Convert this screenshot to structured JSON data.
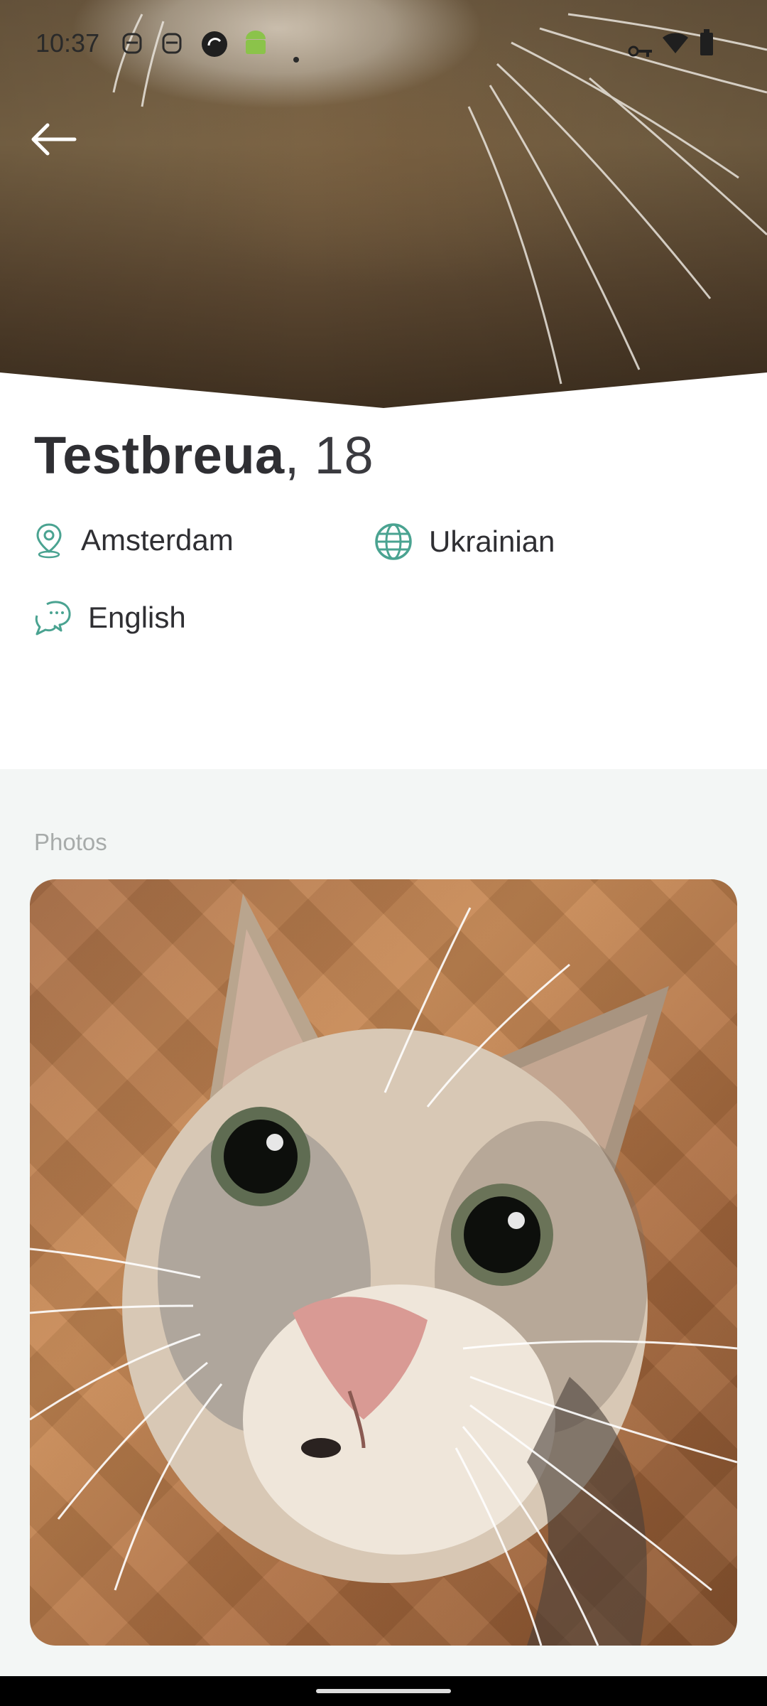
{
  "status_bar": {
    "time": "10:37",
    "icons": [
      "robot-icon",
      "robot-icon",
      "sync-icon",
      "android-icon",
      "dot-icon",
      "vpn-key-icon",
      "wifi-icon",
      "battery-icon"
    ]
  },
  "header": {
    "back_icon": "arrow-left-icon"
  },
  "profile": {
    "name": "Testbreua",
    "age_text": ", 18",
    "details": [
      {
        "icon": "location-pin-icon",
        "label": "Amsterdam"
      },
      {
        "icon": "globe-icon",
        "label": "Ukrainian"
      },
      {
        "icon": "chat-bubbles-icon",
        "label": "English"
      }
    ]
  },
  "photos": {
    "title": "Photos",
    "items": [
      {
        "description_icon": "cat-photo"
      }
    ]
  },
  "colors": {
    "accent": "#4aa391",
    "text_primary": "#2f2f33",
    "section_bg": "#f3f6f5",
    "muted": "#a7abaa"
  }
}
